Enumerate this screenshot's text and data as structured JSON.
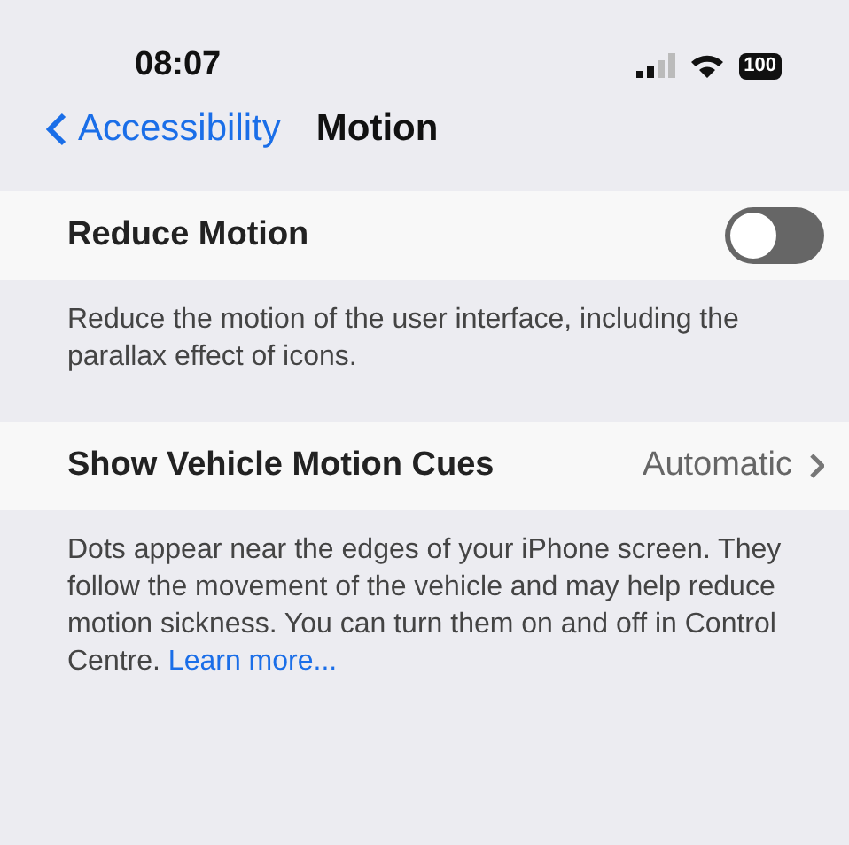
{
  "status_bar": {
    "time": "08:07",
    "battery": "100"
  },
  "nav": {
    "back": "Accessibility",
    "title": "Motion"
  },
  "sections": [
    {
      "kind": "toggle",
      "label": "Reduce Motion",
      "on": false,
      "footer": "Reduce the motion of the user interface, including the parallax effect of icons."
    },
    {
      "kind": "disclosure",
      "label": "Show Vehicle Motion Cues",
      "value": "Automatic",
      "footer": "Dots appear near the edges of your iPhone screen. They follow the movement of the vehicle and may help reduce motion sickness. You can turn them on and off in Control Centre.",
      "footer_link": "Learn more..."
    }
  ]
}
